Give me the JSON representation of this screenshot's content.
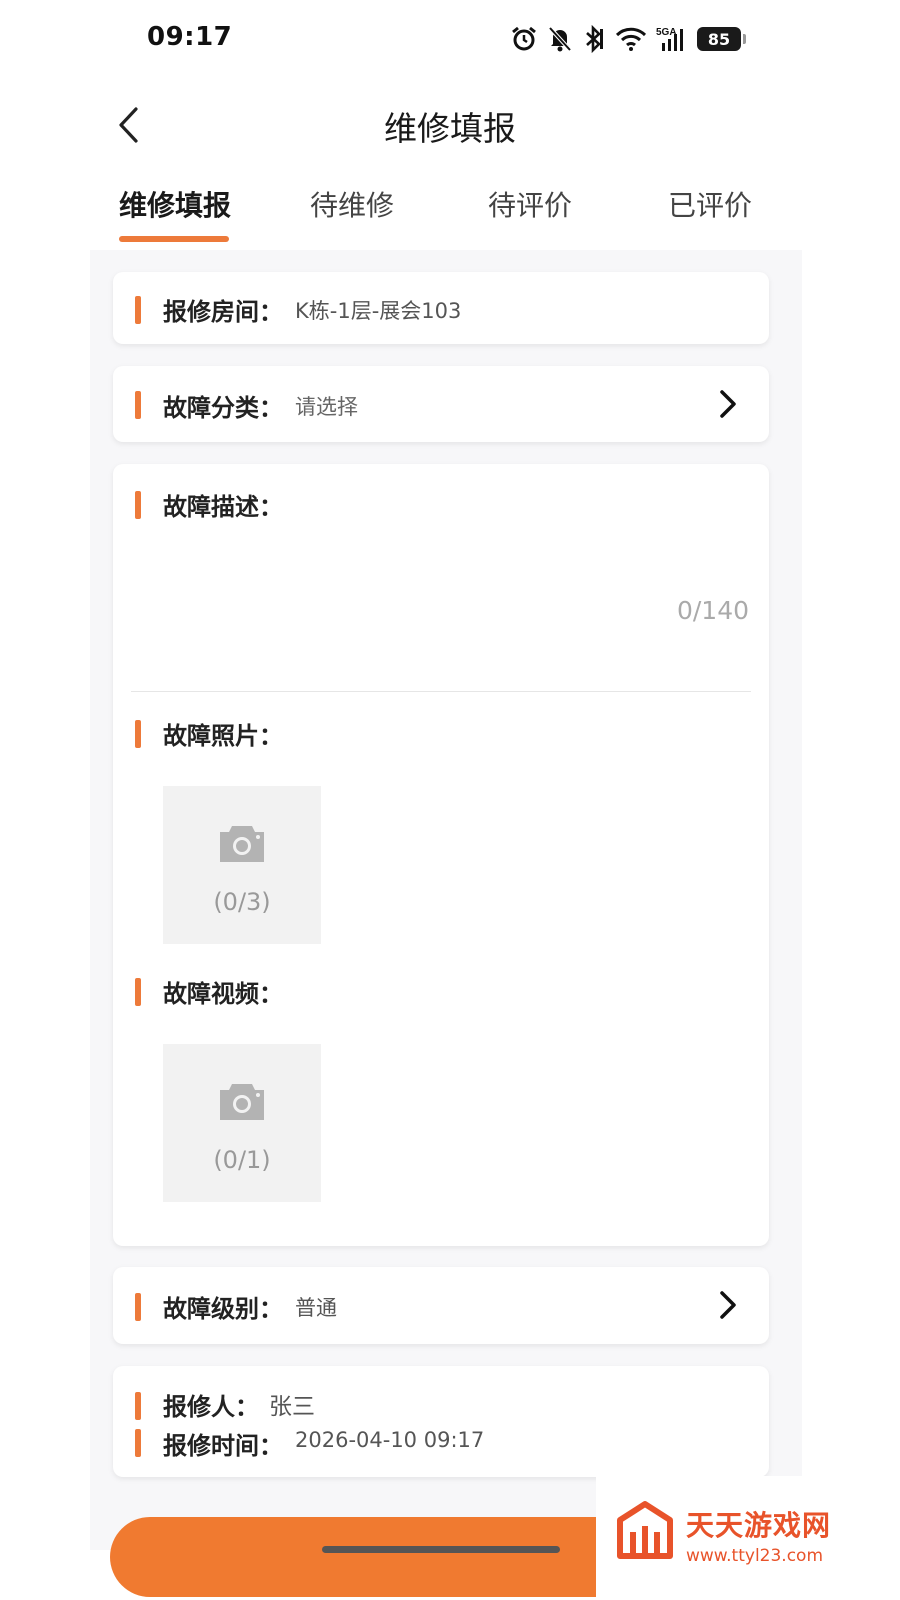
{
  "status_bar": {
    "time": "09:17",
    "battery": "85",
    "icons": [
      "alarm-icon",
      "mute-icon",
      "bluetooth-icon",
      "wifi-icon",
      "signal-5ga-icon",
      "battery-icon"
    ]
  },
  "nav": {
    "title": "维修填报",
    "back_icon": "chevron-left-icon"
  },
  "tabs": [
    {
      "label": "维修填报",
      "active": true
    },
    {
      "label": "待维修",
      "active": false
    },
    {
      "label": "待评价",
      "active": false
    },
    {
      "label": "已评价",
      "active": false
    }
  ],
  "form": {
    "room": {
      "label": "报修房间：",
      "value": "K栋-1层-展会103"
    },
    "category": {
      "label": "故障分类：",
      "placeholder": "请选择"
    },
    "description": {
      "label": "故障描述：",
      "counter": "0/140"
    },
    "photos": {
      "label": "故障照片：",
      "count": "(0/3)"
    },
    "videos": {
      "label": "故障视频：",
      "count": "(0/1)"
    },
    "level": {
      "label": "故障级别：",
      "value": "普通"
    },
    "reporter": {
      "label": "报修人：",
      "value": "张三"
    },
    "report_time": {
      "label": "报修时间：",
      "value": "2026-04-10 09:17"
    }
  },
  "watermark": {
    "title": "天天游戏网",
    "url": "www.ttyl23.com"
  },
  "colors": {
    "accent": "#ed7a3a",
    "button": "#f07a30",
    "watermark": "#e8532a"
  }
}
